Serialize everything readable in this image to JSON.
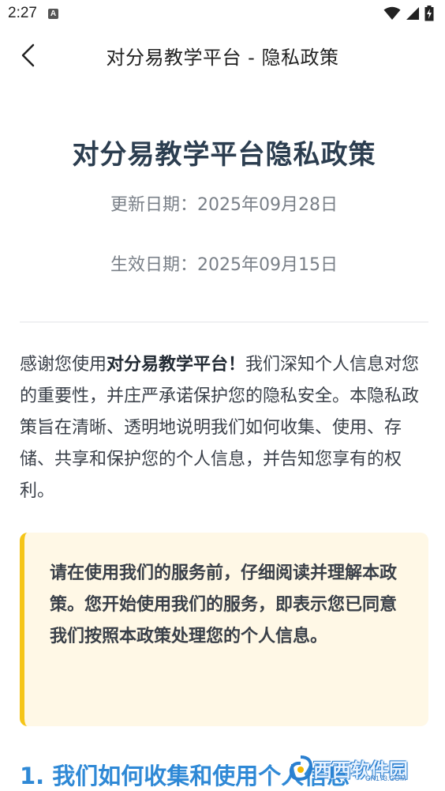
{
  "status_bar": {
    "time": "2:27",
    "notification_icon": "A"
  },
  "app_bar": {
    "back_icon": "chevron-left-icon",
    "title": "对分易教学平台 - 隐私政策"
  },
  "document": {
    "title": "对分易教学平台隐私政策",
    "updated_date": "更新日期：2025年09月28日",
    "effective_date": "生效日期：2025年09月15日",
    "intro": {
      "prefix": "感谢您使用",
      "platform_name": "对分易教学平台",
      "exclaim": "！",
      "suffix": "我们深知个人信息对您的重要性，并庄严承诺保护您的隐私安全。本隐私政策旨在清晰、透明地说明我们如何收集、使用、存储、共享和保护您的个人信息，并告知您享有的权利。"
    },
    "notice": "请在使用我们的服务前，仔细阅读并理解本政策。您开始使用我们的服务，即表示您已同意我们按照本政策处理您的个人信息。",
    "section_1_heading": "1. 我们如何收集和使用个人信息"
  },
  "watermark": {
    "main_text": "西西软件园",
    "sub_text": "CR173.COM"
  },
  "colors": {
    "title": "#2c3e50",
    "heading_accent": "#2f89d6",
    "notice_bg": "#fff8e6",
    "notice_border": "#f5c518"
  }
}
